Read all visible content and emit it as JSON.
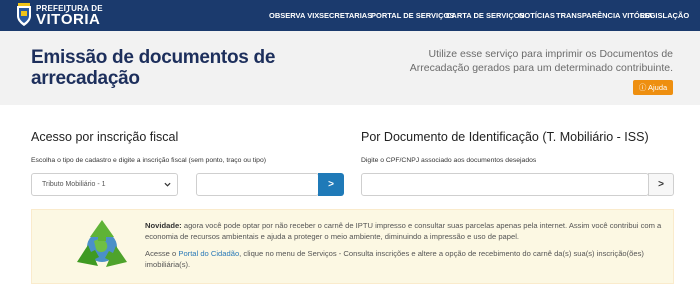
{
  "header": {
    "logo_top": "PREFEITURA DE",
    "logo_main": "VITÓRIA",
    "nav": [
      "OBSERVA VIX",
      "SECRETARIAS",
      "PORTAL DE SERVIÇOS",
      "CARTA DE SERVIÇOS",
      "NOTÍCIAS",
      "TRANSPARÊNCIA VITÓRIA",
      "LEGISLAÇÃO"
    ]
  },
  "hero": {
    "title": "Emissão de documentos de arrecadação",
    "description": "Utilize esse serviço para imprimir os Documentos de Arrecadação gerados para um determinado contribuinte.",
    "help_label": "Ajuda"
  },
  "left_section": {
    "title": "Acesso por inscrição fiscal",
    "hint": "Escolha o tipo de cadastro e digite a inscrição fiscal (sem ponto, traço ou tipo)",
    "select_value": "Tributo Mobiliário - 1",
    "input_value": "",
    "go_label": ">"
  },
  "right_section": {
    "title": "Por Documento de Identificação (T. Mobiliário - ISS)",
    "hint": "Digite o CPF/CNPJ associado aos documentos desejados",
    "input_value": "",
    "go_label": ">"
  },
  "notice": {
    "label": "Novidade:",
    "text1": "agora você pode optar por não receber o carnê de IPTU impresso e consultar suas parcelas apenas pela internet. Assim você contribui com a economia de recursos ambientais e ajuda a proteger o meio ambiente, diminuindo a impressão e uso de papel.",
    "text2_before": "Acesse o",
    "link": "Portal do Cidadão",
    "text2_after": ", clique no menu de Serviços - Consulta inscrições e altere a opção de recebimento do carnê da(s) sua(s) inscrição(ões) imobiliária(s).",
    "icon": "recycle-icon"
  },
  "colors": {
    "navbar": "#1b3a6d",
    "title": "#1d2f5c",
    "help_button": "#ee8f10",
    "primary_button": "#1f7ab8",
    "notice_bg": "#fcf8e3",
    "link": "#2a7ab8"
  }
}
